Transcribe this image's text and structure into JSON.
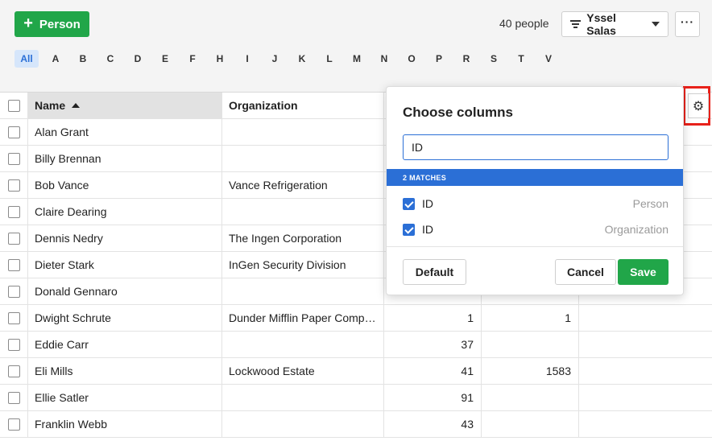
{
  "toolbar": {
    "add_person_label": "Person",
    "people_count": "40 people",
    "filter_label": "Yssel Salas",
    "more_label": "···"
  },
  "alphabet": [
    "All",
    "A",
    "B",
    "C",
    "D",
    "E",
    "F",
    "H",
    "I",
    "J",
    "K",
    "L",
    "M",
    "N",
    "O",
    "P",
    "R",
    "S",
    "T",
    "V"
  ],
  "table": {
    "columns": [
      "Name",
      "Organization"
    ],
    "rows": [
      {
        "name": "Alan Grant",
        "org": "",
        "n1": "",
        "n2": ""
      },
      {
        "name": "Billy Brennan",
        "org": "",
        "n1": "",
        "n2": ""
      },
      {
        "name": "Bob Vance",
        "org": "Vance Refrigeration",
        "n1": "",
        "n2": ""
      },
      {
        "name": "Claire Dearing",
        "org": "",
        "n1": "",
        "n2": ""
      },
      {
        "name": "Dennis Nedry",
        "org": "The Ingen Corporation",
        "n1": "",
        "n2": ""
      },
      {
        "name": "Dieter Stark",
        "org": "InGen Security Division",
        "n1": "",
        "n2": ""
      },
      {
        "name": "Donald Gennaro",
        "org": "",
        "n1": "",
        "n2": ""
      },
      {
        "name": "Dwight Schrute",
        "org": "Dunder Mifflin Paper Comp…",
        "n1": "1",
        "n2": "1"
      },
      {
        "name": "Eddie Carr",
        "org": "",
        "n1": "37",
        "n2": ""
      },
      {
        "name": "Eli Mills",
        "org": "Lockwood Estate",
        "n1": "41",
        "n2": "1583"
      },
      {
        "name": "Ellie Satler",
        "org": "",
        "n1": "91",
        "n2": ""
      },
      {
        "name": "Franklin Webb",
        "org": "",
        "n1": "43",
        "n2": ""
      }
    ]
  },
  "popup": {
    "title": "Choose columns",
    "search_value": "ID",
    "matches_label": "2 MATCHES",
    "matches": [
      {
        "label": "ID",
        "source": "Person"
      },
      {
        "label": "ID",
        "source": "Organization"
      }
    ],
    "default_label": "Default",
    "cancel_label": "Cancel",
    "save_label": "Save"
  },
  "colors": {
    "green": "#21a649",
    "blue": "#2b6fd6",
    "highlight_red": "#e8211a"
  }
}
